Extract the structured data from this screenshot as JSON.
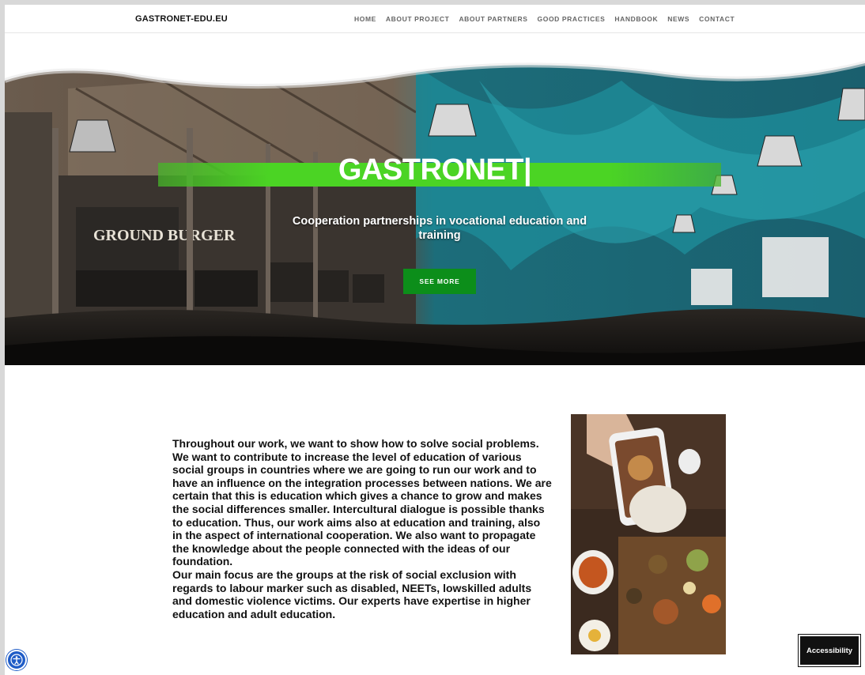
{
  "header": {
    "brand": "GASTRONET-EDU.EU",
    "nav": [
      "HOME",
      "ABOUT PROJECT",
      "ABOUT PARTNERS",
      "GOOD PRACTICES",
      "HANDBOOK",
      "NEWS",
      "CONTACT"
    ]
  },
  "hero": {
    "title": "GASTRONET|",
    "subtitle": "Cooperation partnerships in vocational education and training",
    "cta_label": "SEE MORE",
    "accent_color": "#4bd424",
    "button_color": "#0c8e1a"
  },
  "main": {
    "paragraph_1": "Throughout our work, we want to show how to solve social problems. We want to contribute to increase the level of education of various social groups in countries where we are going to run our work and to have an influence on the integration processes between nations. We are certain that this is education which gives a chance to grow and makes the social differences smaller. Intercultural dialogue is possible thanks to education. Thus, our work aims also at education and training, also in the aspect of international cooperation. We also want to propagate the knowledge about the people connected with the ideas of our foundation.",
    "paragraph_2": "Our main focus are the groups at the risk of social exclusion with regards to labour marker such as disabled, NEETs, lowskilled adults and domestic violence victims. Our experts have expertise in higher education and adult education."
  },
  "widgets": {
    "accessibility_label": "Accessibility",
    "accessibility_icon": "accessibility-icon"
  }
}
